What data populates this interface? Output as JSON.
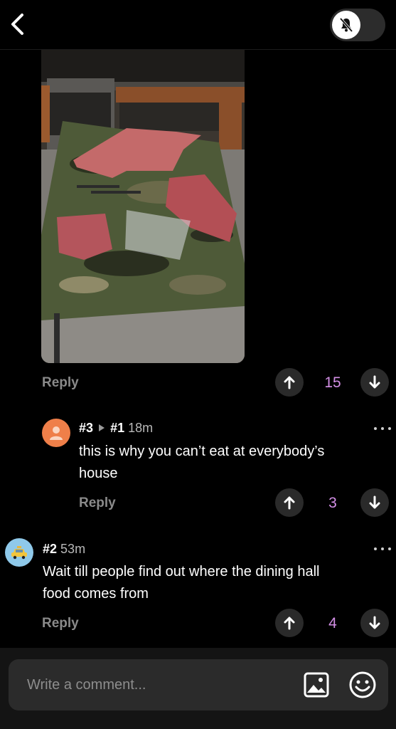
{
  "header": {
    "back_icon": "chevron-left-icon",
    "mute_icon": "bell-slash-icon"
  },
  "post": {
    "reply_label": "Reply",
    "score": "15"
  },
  "comments": [
    {
      "id": "#3",
      "parent": "#1",
      "time": "18m",
      "text_line1": "this is why you can’t eat at everybody’s",
      "text_line2": "house",
      "reply_label": "Reply",
      "score": "3",
      "avatar_color": "#ef7f49"
    },
    {
      "id": "#2",
      "time": "53m",
      "text_line1": "Wait till people find out where the dining hall",
      "text_line2": "food comes from",
      "reply_label": "Reply",
      "score": "4",
      "avatar_color": "#8fc9ea"
    }
  ],
  "composer": {
    "placeholder": "Write a comment...",
    "image_icon": "image-icon",
    "emoji_icon": "emoji-icon"
  },
  "colors": {
    "background": "#000000",
    "vote_count": "#d38fe6",
    "muted_text": "#8a8a8a"
  }
}
